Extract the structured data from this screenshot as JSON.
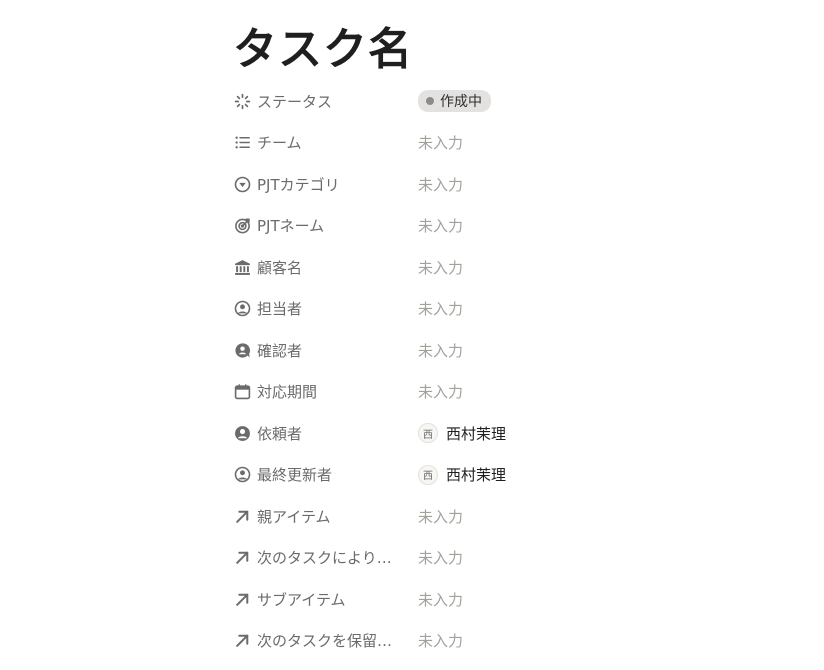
{
  "page": {
    "title": "タスク名"
  },
  "properties": [
    {
      "label": "ステータス",
      "icon": "status-spinner-icon",
      "type": "status",
      "value": "作成中",
      "status_color": "#8c8b87"
    },
    {
      "label": "チーム",
      "icon": "list-icon",
      "type": "empty",
      "value": "未入力"
    },
    {
      "label": "PJTカテゴリ",
      "icon": "select-circle-icon",
      "type": "empty",
      "value": "未入力"
    },
    {
      "label": "PJTネーム",
      "icon": "target-icon",
      "type": "empty",
      "value": "未入力"
    },
    {
      "label": "顧客名",
      "icon": "bank-icon",
      "type": "empty",
      "value": "未入力"
    },
    {
      "label": "担当者",
      "icon": "person-circle-icon",
      "type": "empty",
      "value": "未入力"
    },
    {
      "label": "確認者",
      "icon": "person-bubble-icon",
      "type": "empty",
      "value": "未入力"
    },
    {
      "label": "対応期間",
      "icon": "calendar-icon",
      "type": "empty",
      "value": "未入力"
    },
    {
      "label": "依頼者",
      "icon": "person-filled-icon",
      "type": "person",
      "value": "西村茉理",
      "avatar": "西"
    },
    {
      "label": "最終更新者",
      "icon": "person-circle-icon",
      "type": "person",
      "value": "西村茉理",
      "avatar": "西"
    },
    {
      "label": "親アイテム",
      "icon": "arrow-up-right-icon",
      "type": "empty",
      "value": "未入力"
    },
    {
      "label": "次のタスクにより…",
      "icon": "arrow-up-right-icon",
      "type": "empty",
      "value": "未入力"
    },
    {
      "label": "サブアイテム",
      "icon": "arrow-up-right-icon",
      "type": "empty",
      "value": "未入力"
    },
    {
      "label": "次のタスクを保留…",
      "icon": "arrow-up-right-icon",
      "type": "empty",
      "value": "未入力"
    }
  ],
  "colors": {
    "label_text": "#6b6b6b",
    "empty_text": "#a3a19c",
    "status_bg": "#e3e2e0"
  }
}
